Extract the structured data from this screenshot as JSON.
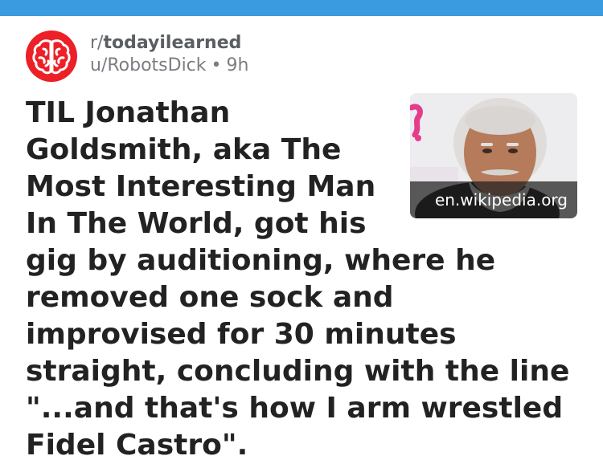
{
  "post": {
    "subreddit_prefix": "r/",
    "subreddit_name": "todayilearned",
    "author": "u/RobotsDick",
    "separator": "•",
    "age": "9h",
    "title": "TIL Jonathan Goldsmith, aka The Most Interesting Man In The World, got his gig by auditioning, where he removed one sock and improvised for 30 minutes straight, concluding with the line \"...and that's how I arm wrestled Fidel Castro\".",
    "link_domain": "en.wikipedia.org"
  },
  "colors": {
    "top_bar": "#3a9be0",
    "avatar_bg": "#ec2027",
    "title_text": "#222222",
    "meta_text": "#7a7e83"
  },
  "icons": {
    "avatar": "brain-icon"
  }
}
